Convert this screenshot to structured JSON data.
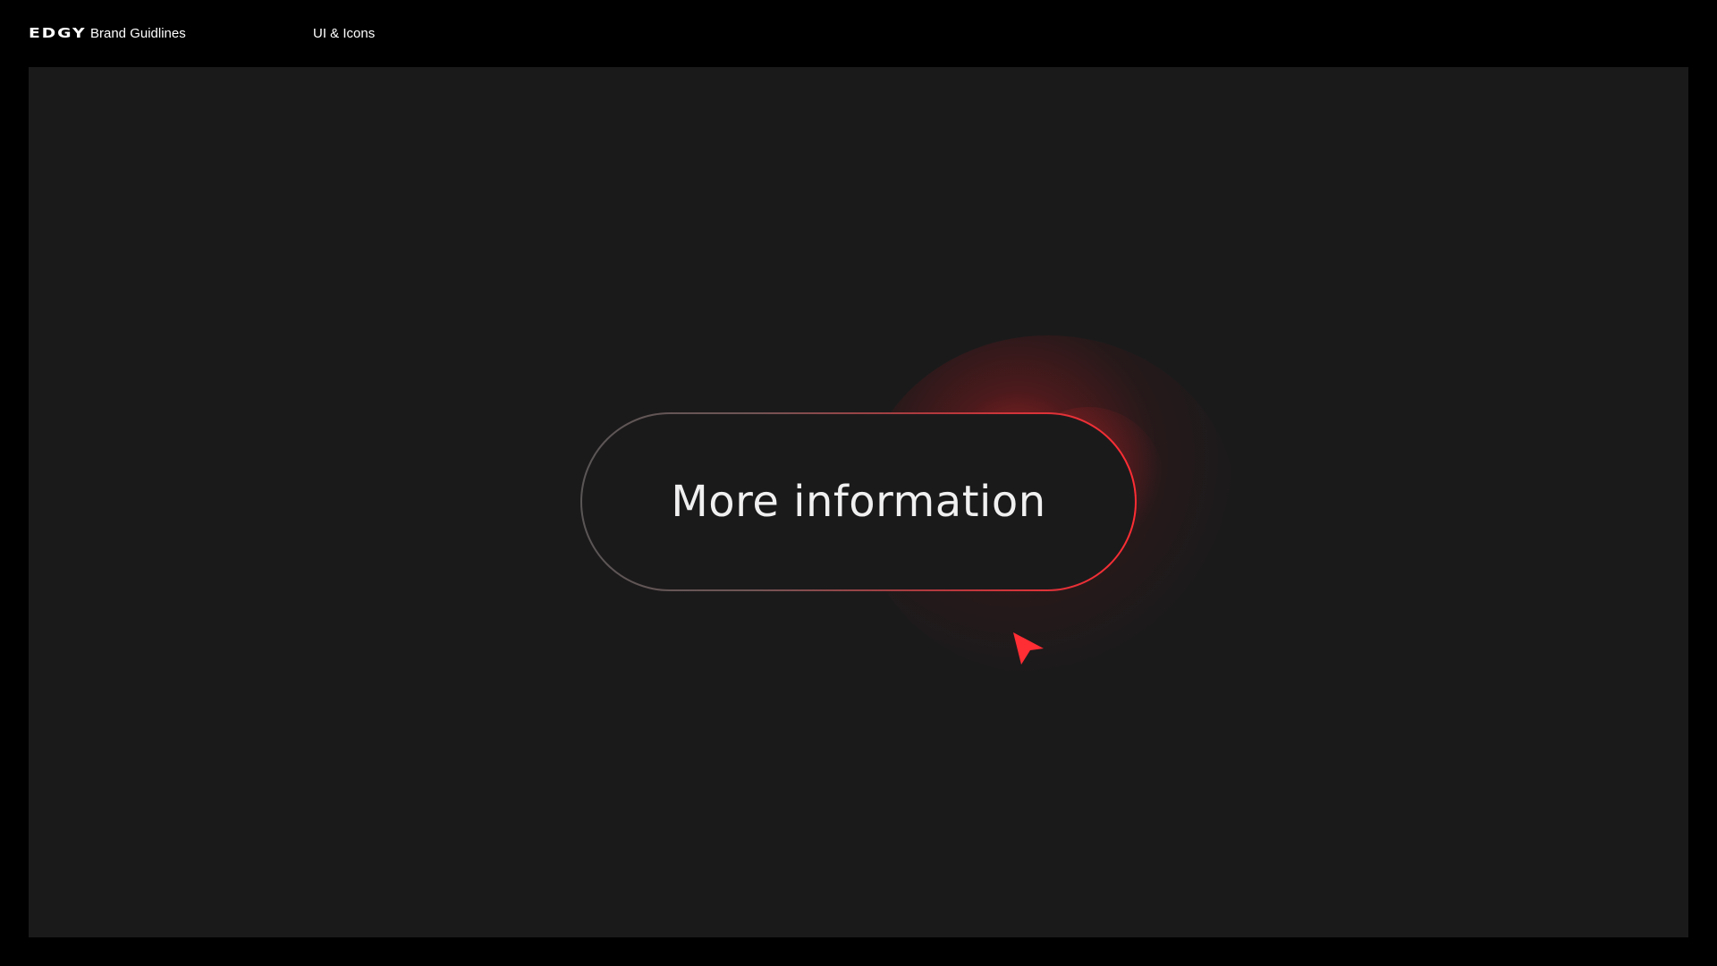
{
  "header": {
    "logo_text": "EDGY",
    "brand_title": "Brand Guidlines",
    "section_title": "UI & Icons"
  },
  "main": {
    "button_label": "More information",
    "cursor_icon": "pointer-arrow-icon"
  },
  "colors": {
    "page_background": "#000000",
    "canvas_background": "#1b1a1b",
    "accent": "#ff2d34",
    "button_border_neutral": "#5a5656",
    "text": "#f1f0f0"
  }
}
